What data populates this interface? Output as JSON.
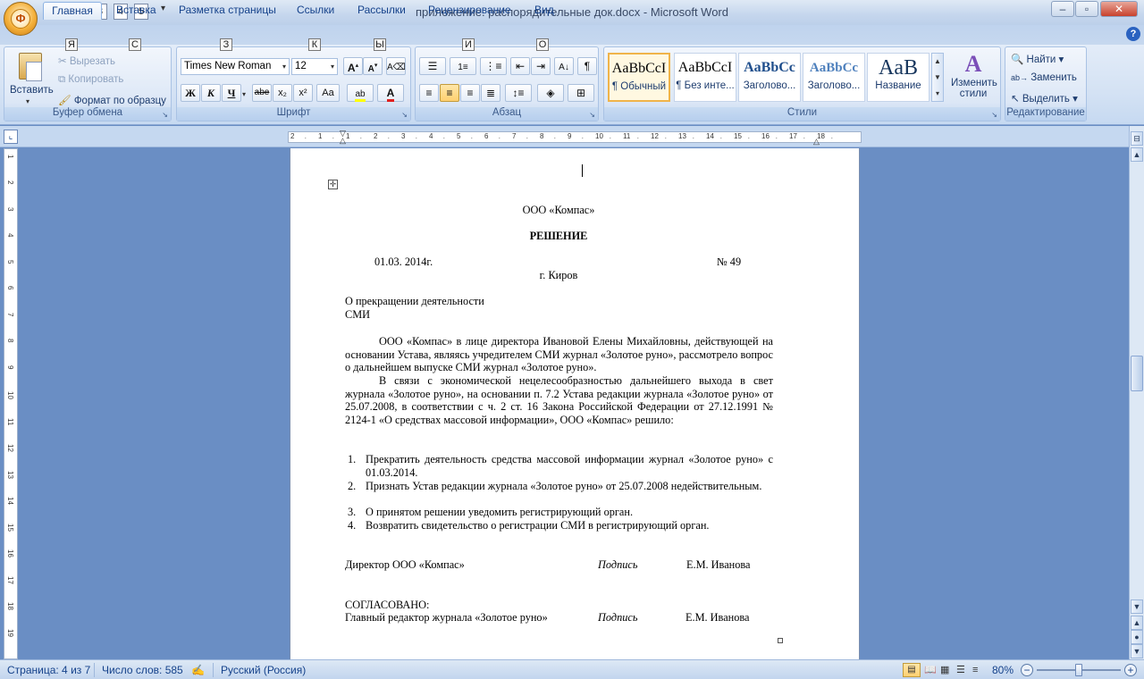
{
  "window": {
    "title": "приложение. распорядительные док.docx - Microsoft Word",
    "office_button_key": "Ф",
    "qat_keys": [
      "1",
      "2",
      "3",
      "4",
      "5"
    ],
    "minimize": "–",
    "maximize": "▫",
    "close": "✕"
  },
  "tabs": [
    {
      "label": "Главная",
      "key": "Я"
    },
    {
      "label": "Вставка",
      "key": "С"
    },
    {
      "label": "Разметка страницы",
      "key": "З"
    },
    {
      "label": "Ссылки",
      "key": "К"
    },
    {
      "label": "Рассылки",
      "key": "Ы"
    },
    {
      "label": "Рецензирование",
      "key": "И"
    },
    {
      "label": "Вид",
      "key": "О"
    }
  ],
  "clipboard": {
    "paste": "Вставить",
    "cut": "Вырезать",
    "copy": "Копировать",
    "format_painter": "Формат по образцу",
    "label": "Буфер обмена"
  },
  "font": {
    "name": "Times New Roman",
    "size": "12",
    "bold": "Ж",
    "italic": "К",
    "underline": "Ч",
    "strike": "abe",
    "subscript": "x₂",
    "superscript": "x²",
    "change_case": "Aa",
    "label": "Шрифт"
  },
  "paragraph": {
    "label": "Абзац"
  },
  "styles": {
    "items": [
      {
        "sample": "AaBbCcI",
        "name": "¶ Обычный"
      },
      {
        "sample": "AaBbCcI",
        "name": "¶ Без инте..."
      },
      {
        "sample": "AaBbCc",
        "name": "Заголово..."
      },
      {
        "sample": "AaBbCc",
        "name": "Заголово..."
      },
      {
        "sample": "AaB",
        "name": "Название"
      }
    ],
    "change_styles_1": "Изменить",
    "change_styles_2": "стили",
    "label": "Стили"
  },
  "editing": {
    "find": "Найти",
    "replace": "Заменить",
    "select": "Выделить",
    "label": "Редактирование"
  },
  "ruler": {
    "h_numbers": [
      "2",
      "1",
      "1",
      "2",
      "3",
      "4",
      "5",
      "6",
      "7",
      "8",
      "9",
      "10",
      "11",
      "12",
      "13",
      "14",
      "15",
      "16",
      "17",
      "18"
    ],
    "v_numbers": [
      "1",
      "2",
      "3",
      "4",
      "5",
      "6",
      "7",
      "8",
      "9",
      "10",
      "11",
      "12",
      "13",
      "14",
      "15",
      "16",
      "17",
      "18",
      "19"
    ]
  },
  "document": {
    "org": "ООО «Компас»",
    "heading": "РЕШЕНИЕ",
    "date": "01.03. 2014г.",
    "number": "№ 49",
    "city": "г. Киров",
    "subject_1": "О прекращении деятельности",
    "subject_2": "СМИ",
    "para1": "ООО «Компас» в лице директора Ивановой Елены Михайловны, действующей на основании Устава, являясь учредителем СМИ журнал «Золотое руно», рассмотрело вопрос о дальнейшем выпуске СМИ журнал «Золотое руно».",
    "para2": "В связи с экономической нецелесообразностью дальнейшего выхода в свет журнала «Золотое руно», на основании п. 7.2 Устава редакции журнала «Золотое руно» от 25.07.2008, в соответствии с ч. 2 ст. 16 Закона Российской Федерации от 27.12.1991 № 2124-1 «О средствах массовой информации», ООО «Компас» решило:",
    "list": [
      "Прекратить деятельность средства массовой информации журнал «Золотое руно» с 01.03.2014.",
      "Признать Устав редакции журнала «Золотое руно» от 25.07.2008 недействительным.",
      "О принятом решении уведомить регистрирующий орган.",
      "Возвратить свидетельство о регистрации СМИ в регистрирующий орган."
    ],
    "sign1_role": "Директор ООО «Компас»",
    "sign1_sig": "Подпись",
    "sign1_name": "Е.М. Иванова",
    "agreed": "СОГЛАСОВАНО:",
    "sign2_role": "Главный редактор журнала «Золотое руно»",
    "sign2_sig": "Подпись",
    "sign2_name": "Е.М. Иванова"
  },
  "status": {
    "page": "Страница: 4 из 7",
    "words": "Число слов: 585",
    "language": "Русский (Россия)",
    "zoom": "80%",
    "zoom_fraction": 0.5
  }
}
